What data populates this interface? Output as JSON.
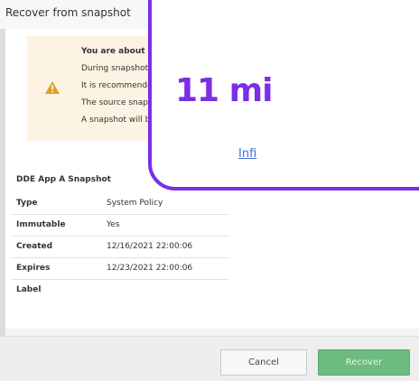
{
  "dialog": {
    "title": "Recover from snapshot"
  },
  "warning": {
    "lines": [
      "You are about to",
      "During snapshot",
      "It is recommende",
      "The source snaps",
      "A snapshot will be"
    ],
    "icon": "warning-triangle-icon",
    "icon_color": "#e0a020",
    "bg_color": "#fcf3e3"
  },
  "snapshot": {
    "title": "DDE App A Snapshot",
    "rows": [
      {
        "key": "Type",
        "value": "System Policy"
      },
      {
        "key": "Immutable",
        "value": "Yes"
      },
      {
        "key": "Created",
        "value": "12/16/2021 22:00:06"
      },
      {
        "key": "Expires",
        "value": "12/23/2021 22:00:06"
      },
      {
        "key": "Label",
        "value": ""
      }
    ]
  },
  "footer": {
    "cancel_label": "Cancel",
    "recover_label": "Recover",
    "recover_color": "#6dbb7e"
  },
  "overlay": {
    "big_text": "11 mi",
    "link_text": "Infi",
    "accent_color": "#7b2ee6",
    "link_color": "#3f6fe0"
  }
}
